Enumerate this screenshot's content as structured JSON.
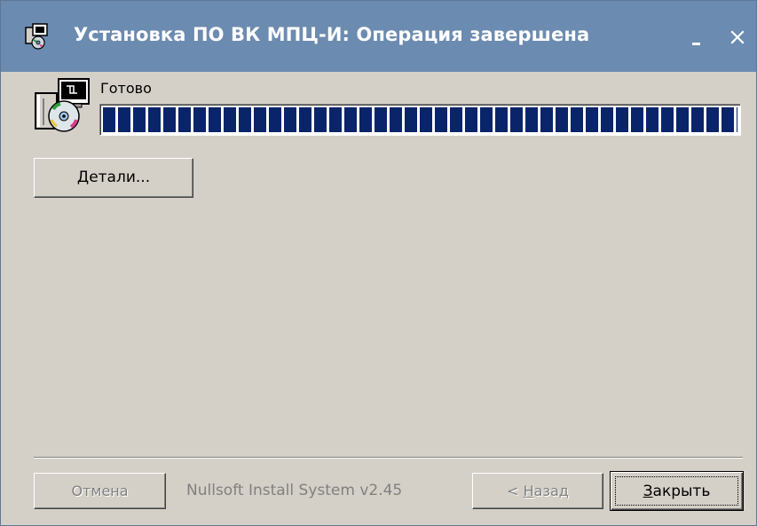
{
  "window": {
    "title": "Установка ПО ВК МПЦ-И: Операция завершена"
  },
  "status": {
    "label": "Готово",
    "progress_percent": 100
  },
  "details_button": {
    "mnemonic": "Д",
    "rest": "етали..."
  },
  "footer": {
    "cancel_label": "Отмена",
    "branding": "Nullsoft Install System v2.45",
    "back_prefix": "< ",
    "back_mnemonic": "Н",
    "back_rest": "азад",
    "close_mnemonic": "З",
    "close_rest": "акрыть"
  },
  "icons": {
    "title": "installer-icon",
    "body": "installer-cd-icon",
    "minimize": "minimize-icon",
    "close": "close-icon"
  },
  "colors": {
    "titlebar": "#6c8bb0",
    "progress": "#0a246a",
    "face": "#d4d0c8"
  }
}
